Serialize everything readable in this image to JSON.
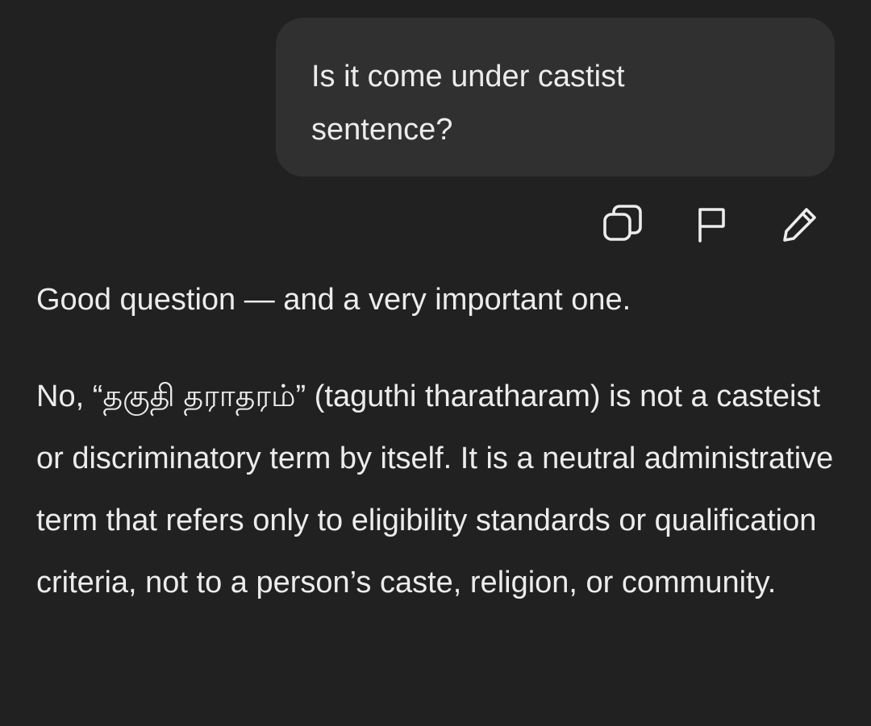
{
  "conversation": {
    "user_message": "Is it come under castist sentence?",
    "message_actions": {
      "copy_icon": "copy-icon",
      "flag_icon": "flag-icon",
      "edit_icon": "pencil-icon"
    },
    "assistant_response": {
      "paragraph_1": "Good question — and a very important one.",
      "paragraph_2": "No, “தகுதி தராதரம்” (taguthi tharatharam) is not a casteist or discriminatory term by itself. It is a neutral administrative term that refers only to eligibility standards or qualification criteria, not to a person’s caste, religion, or community."
    }
  },
  "theme": {
    "background": "#212121",
    "bubble": "#303030",
    "text": "#ececec"
  }
}
